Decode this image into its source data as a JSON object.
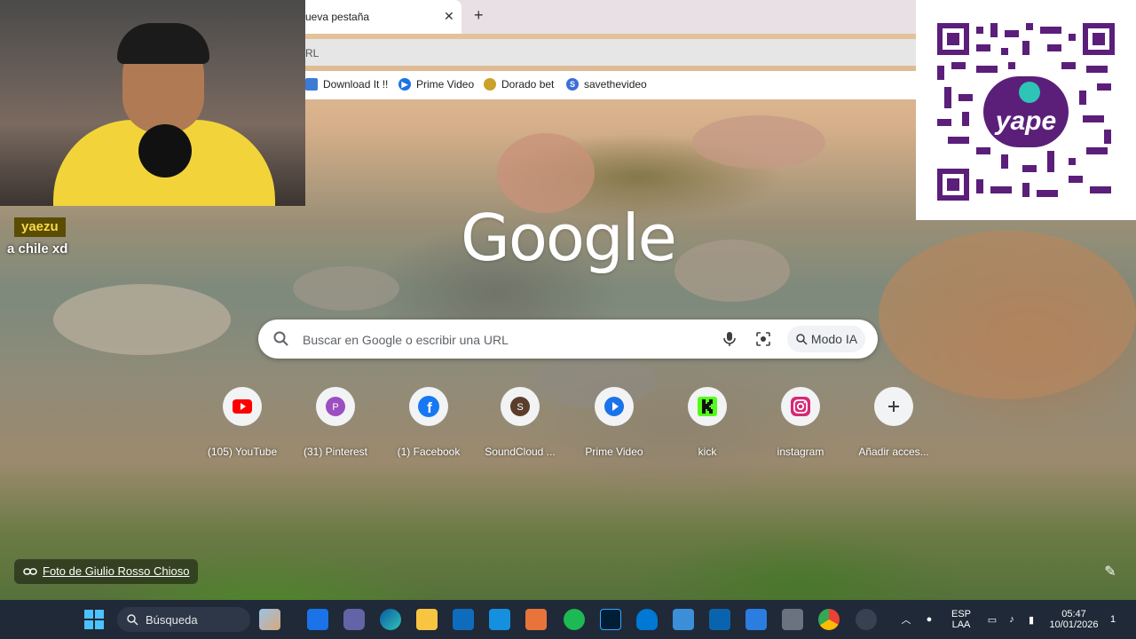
{
  "browser": {
    "tab_title": "ueva pestaña",
    "new_tab": "+",
    "close": "✕",
    "omnibox_text": "RL"
  },
  "bookmarks": [
    {
      "label": "Download It !!",
      "icon": "folder-icon"
    },
    {
      "label": "Prime Video",
      "icon": "prime-video-icon"
    },
    {
      "label": "Dorado bet",
      "icon": "dorado-bet-icon"
    },
    {
      "label": "savethevideo",
      "icon": "savethevideo-icon"
    }
  ],
  "stream": {
    "chat_user": "yaezu",
    "chat_message": "a chile xd",
    "qr_brand": "yape"
  },
  "google": {
    "logo": "Google",
    "search_placeholder": "Buscar en Google o escribir una URL",
    "ai_mode_label": "Modo IA"
  },
  "shortcuts": [
    {
      "label": "(105) YouTube",
      "icon": "youtube-icon",
      "color": "#ff0000"
    },
    {
      "label": "(31) Pinterest",
      "icon": "pinterest-icon",
      "color": "#9c4fc0",
      "letter": "P"
    },
    {
      "label": "(1) Facebook",
      "icon": "facebook-icon",
      "color": "#1877f2"
    },
    {
      "label": "SoundCloud ...",
      "icon": "soundcloud-icon",
      "color": "#5a3e2b",
      "letter": "S"
    },
    {
      "label": "Prime Video",
      "icon": "prime-video-icon",
      "color": "#1a73e8"
    },
    {
      "label": "kick",
      "icon": "kick-icon",
      "color": "#53fc18"
    },
    {
      "label": "instagram",
      "icon": "instagram-icon",
      "color": "#d62976"
    },
    {
      "label": "Añadir acces...",
      "icon": "plus-icon",
      "color": "#3c4043"
    }
  ],
  "photo_credit": "Foto de Giulio Rosso Chioso",
  "taskbar": {
    "search_label": "Búsqueda",
    "lang_top": "ESP",
    "lang_bottom": "LAA",
    "time": "05:47",
    "date": "10/01/2026",
    "notification_count": "1"
  }
}
